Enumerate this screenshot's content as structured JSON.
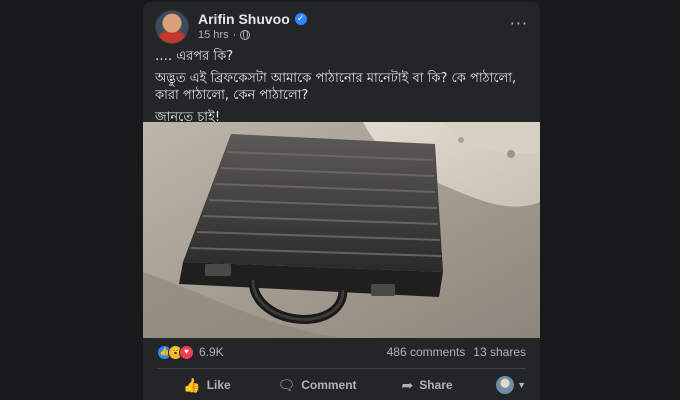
{
  "post": {
    "author": "Arifin Shuvoo",
    "time": "15 hrs",
    "more_label": "···",
    "lines": [
      "…. এরপর কি?",
      "অদ্ভুত এই ব্রিফকেসটা আমাকে পাঠানোর মানেটাই বা কি? কে পাঠালো, কারা পাঠালো, কেন পাঠালো?",
      "জানতে চাই!"
    ]
  },
  "stats": {
    "reactions": "6.9K",
    "comments": "486 comments",
    "shares": "13 shares"
  },
  "actions": {
    "like": "Like",
    "comment": "Comment",
    "share": "Share"
  },
  "icons": {
    "verified": "verified-badge-icon",
    "privacy": "globe-icon",
    "like": "thumbs-up-icon",
    "comment": "comment-bubble-icon",
    "share": "share-arrow-icon"
  },
  "colors": {
    "background": "#18191a",
    "card": "#242526",
    "accent": "#2d88ff",
    "secondary_text": "#b0b3b8"
  }
}
